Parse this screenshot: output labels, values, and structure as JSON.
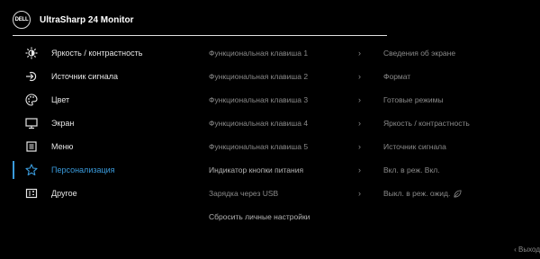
{
  "header": {
    "logo_text": "DELL",
    "title": "UltraSharp 24 Monitor"
  },
  "menu": [
    {
      "id": "brightness",
      "label": "Яркость / контрастность",
      "icon": "brightness-icon"
    },
    {
      "id": "input",
      "label": "Источник сигнала",
      "icon": "input-source-icon"
    },
    {
      "id": "color",
      "label": "Цвет",
      "icon": "color-palette-icon"
    },
    {
      "id": "display",
      "label": "Экран",
      "icon": "display-monitor-icon"
    },
    {
      "id": "menu",
      "label": "Меню",
      "icon": "menu-icon"
    },
    {
      "id": "personalize",
      "label": "Персонализация",
      "icon": "star-icon",
      "active": true
    },
    {
      "id": "others",
      "label": "Другое",
      "icon": "others-icon"
    }
  ],
  "settings": [
    {
      "key": "Функциональная клавиша 1",
      "arrow": "›",
      "value": "Сведения об экране"
    },
    {
      "key": "Функциональная клавиша 2",
      "arrow": "›",
      "value": "Формат"
    },
    {
      "key": "Функциональная клавиша 3",
      "arrow": "›",
      "value": "Готовые режимы"
    },
    {
      "key": "Функциональная клавиша 4",
      "arrow": "›",
      "value": "Яркость / контрастность"
    },
    {
      "key": "Функциональная клавиша 5",
      "arrow": "›",
      "value": "Источник сигнала"
    },
    {
      "key": "Индикатор кнопки питания",
      "arrow": "›",
      "value": "Вкл. в реж. Вкл."
    },
    {
      "key": "Зарядка через USB",
      "arrow": "›",
      "value": "Выкл. в реж. ожид."
    },
    {
      "key": "Сбросить личные настройки",
      "arrow": "",
      "value": ""
    }
  ],
  "footer": {
    "exit_label": "‹ Выход"
  },
  "colors": {
    "accent": "#3a9bdc",
    "background": "#000000"
  }
}
